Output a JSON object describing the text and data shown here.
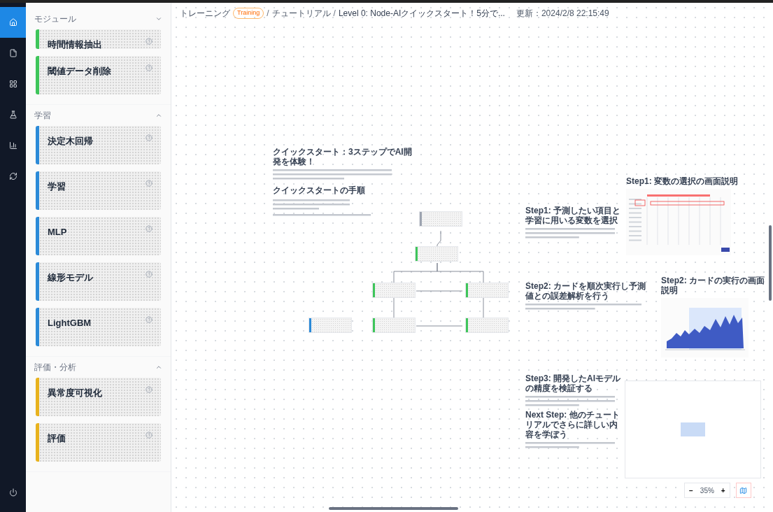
{
  "rail": [
    {
      "kind": "home",
      "selected": true
    },
    {
      "kind": "file",
      "selected": false
    },
    {
      "kind": "grid",
      "selected": false
    },
    {
      "kind": "flask",
      "selected": false
    },
    {
      "kind": "chart",
      "selected": false
    },
    {
      "kind": "sync",
      "selected": false
    },
    {
      "kind": "power",
      "selected": false
    }
  ],
  "sidebar": {
    "sections": [
      {
        "title": "モジュール",
        "expanded": false,
        "color": "#3ec55a",
        "items": [
          {
            "name": "時間情報抽出"
          },
          {
            "name": "閾値データ削除"
          }
        ]
      },
      {
        "title": "学習",
        "expanded": true,
        "color": "#2b8ad8",
        "items": [
          {
            "name": "決定木回帰"
          },
          {
            "name": "学習"
          },
          {
            "name": "MLP"
          },
          {
            "name": "線形モデル"
          },
          {
            "name": "LightGBM"
          }
        ]
      },
      {
        "title": "評価・分析",
        "expanded": true,
        "color": "#e8b21e",
        "items": [
          {
            "name": "異常度可視化"
          },
          {
            "name": "評価"
          }
        ]
      }
    ]
  },
  "breadcrumb": {
    "items": [
      "トレーニング",
      "チュートリアル",
      "Level 0: Node-AIクイックスタート！5分で..."
    ],
    "badge": "Training",
    "separator": "/",
    "updated": "更新：2024/2/8 22:15:49"
  },
  "canvas": {
    "intro": {
      "title": "クイックスタート：3ステップでAI開発を体験！",
      "subtitle": "クイックスタートの手順"
    },
    "steps": [
      {
        "title": "Step1: 予測したい項目と学習に用いる変数を選択"
      },
      {
        "title": "Step2: カードを順次実行し予測値との誤差解析を行う"
      },
      {
        "title": "Step3: 開発したAIモデルの精度を検証する",
        "next": "Next Step: 他のチュートリアルでさらに詳しい内容を学ぼう"
      }
    ],
    "screens": [
      {
        "kind": "table",
        "title": "Step1: 変数の選択の画面説明"
      },
      {
        "kind": "chart",
        "title": "Step2: カードの実行の画面説明"
      }
    ],
    "nodes": [
      {
        "color": "#9ca3af"
      },
      {
        "color": "#3ec55a"
      },
      {
        "color": "#3ec55a"
      },
      {
        "color": "#3ec55a"
      },
      {
        "color": "#2b8ad8"
      },
      {
        "color": "#3ec55a"
      },
      {
        "color": "#3ec55a"
      }
    ]
  },
  "zoom": {
    "minus": "−",
    "value": "35%",
    "plus": "+",
    "minimap_on": true
  }
}
